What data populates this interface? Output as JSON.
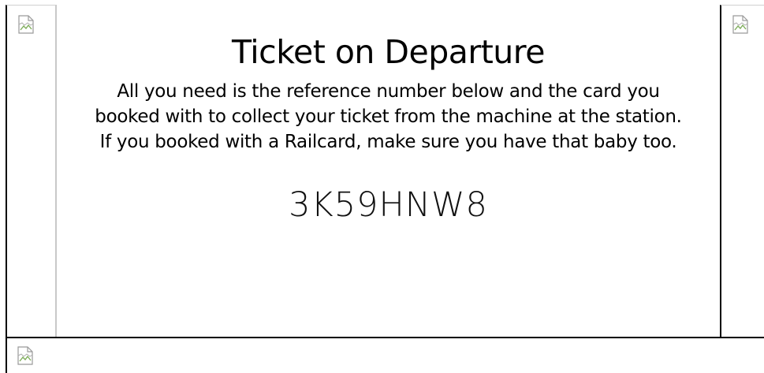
{
  "ticket": {
    "title": "Ticket on Departure",
    "description": "All you need is the reference number below and the card you booked with to collect your ticket from the machine at the station. If you booked with a Railcard, make sure you have that baby too.",
    "reference_number": "3K59HNW8"
  },
  "images": {
    "left_icon": "broken-image-icon",
    "right_icon": "broken-image-icon",
    "bottom_icon": "broken-image-icon"
  }
}
